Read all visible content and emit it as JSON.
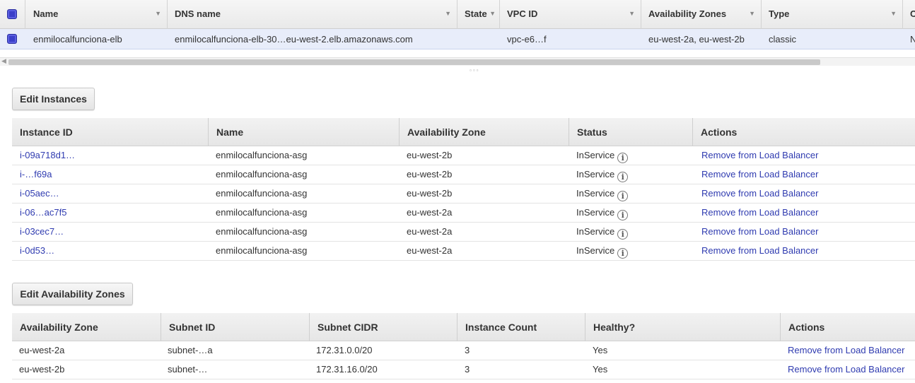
{
  "lb_table": {
    "columns": [
      {
        "label": "Name"
      },
      {
        "label": "DNS name"
      },
      {
        "label": "State"
      },
      {
        "label": "VPC ID"
      },
      {
        "label": "Availability Zones"
      },
      {
        "label": "Type"
      },
      {
        "label": "C"
      }
    ],
    "row": {
      "name": "enmilocalfunciona-elb",
      "dns_name": "enmilocalfunciona-elb-30…eu-west-2.elb.amazonaws.com",
      "state": "",
      "vpc_id": "vpc-e6…f",
      "availability_zones": "eu-west-2a, eu-west-2b",
      "type": "classic",
      "truncated": "N"
    }
  },
  "instances": {
    "button_label": "Edit Instances",
    "columns": [
      "Instance ID",
      "Name",
      "Availability Zone",
      "Status",
      "Actions"
    ],
    "rows": [
      {
        "id": "i-09a718d1…",
        "name": "enmilocalfunciona-asg",
        "zone": "eu-west-2b",
        "status": "InService",
        "action": "Remove from Load Balancer"
      },
      {
        "id": "i-…f69a",
        "name": "enmilocalfunciona-asg",
        "zone": "eu-west-2b",
        "status": "InService",
        "action": "Remove from Load Balancer"
      },
      {
        "id": "i-05aec…",
        "name": "enmilocalfunciona-asg",
        "zone": "eu-west-2b",
        "status": "InService",
        "action": "Remove from Load Balancer"
      },
      {
        "id": "i-06…ac7f5",
        "name": "enmilocalfunciona-asg",
        "zone": "eu-west-2a",
        "status": "InService",
        "action": "Remove from Load Balancer"
      },
      {
        "id": "i-03cec7…",
        "name": "enmilocalfunciona-asg",
        "zone": "eu-west-2a",
        "status": "InService",
        "action": "Remove from Load Balancer"
      },
      {
        "id": "i-0d53…",
        "name": "enmilocalfunciona-asg",
        "zone": "eu-west-2a",
        "status": "InService",
        "action": "Remove from Load Balancer"
      }
    ]
  },
  "zones": {
    "button_label": "Edit Availability Zones",
    "columns": [
      "Availability Zone",
      "Subnet ID",
      "Subnet CIDR",
      "Instance Count",
      "Healthy?",
      "Actions"
    ],
    "rows": [
      {
        "zone": "eu-west-2a",
        "subnet": "subnet-…a",
        "cidr": "172.31.0.0/20",
        "count": "3",
        "healthy": "Yes",
        "action": "Remove from Load Balancer"
      },
      {
        "zone": "eu-west-2b",
        "subnet": "subnet-…",
        "cidr": "172.31.16.0/20",
        "count": "3",
        "healthy": "Yes",
        "action": "Remove from Load Balancer"
      }
    ]
  },
  "icons": {
    "sort": "caret-down-icon",
    "status_info": "info-icon",
    "checkbox": "checkbox-icon",
    "resize_grip": "resize-grip-icon"
  },
  "colors": {
    "link": "#2f3bb0",
    "selected_row": "#e8edfa",
    "checkbox": "#3b3fc9"
  }
}
